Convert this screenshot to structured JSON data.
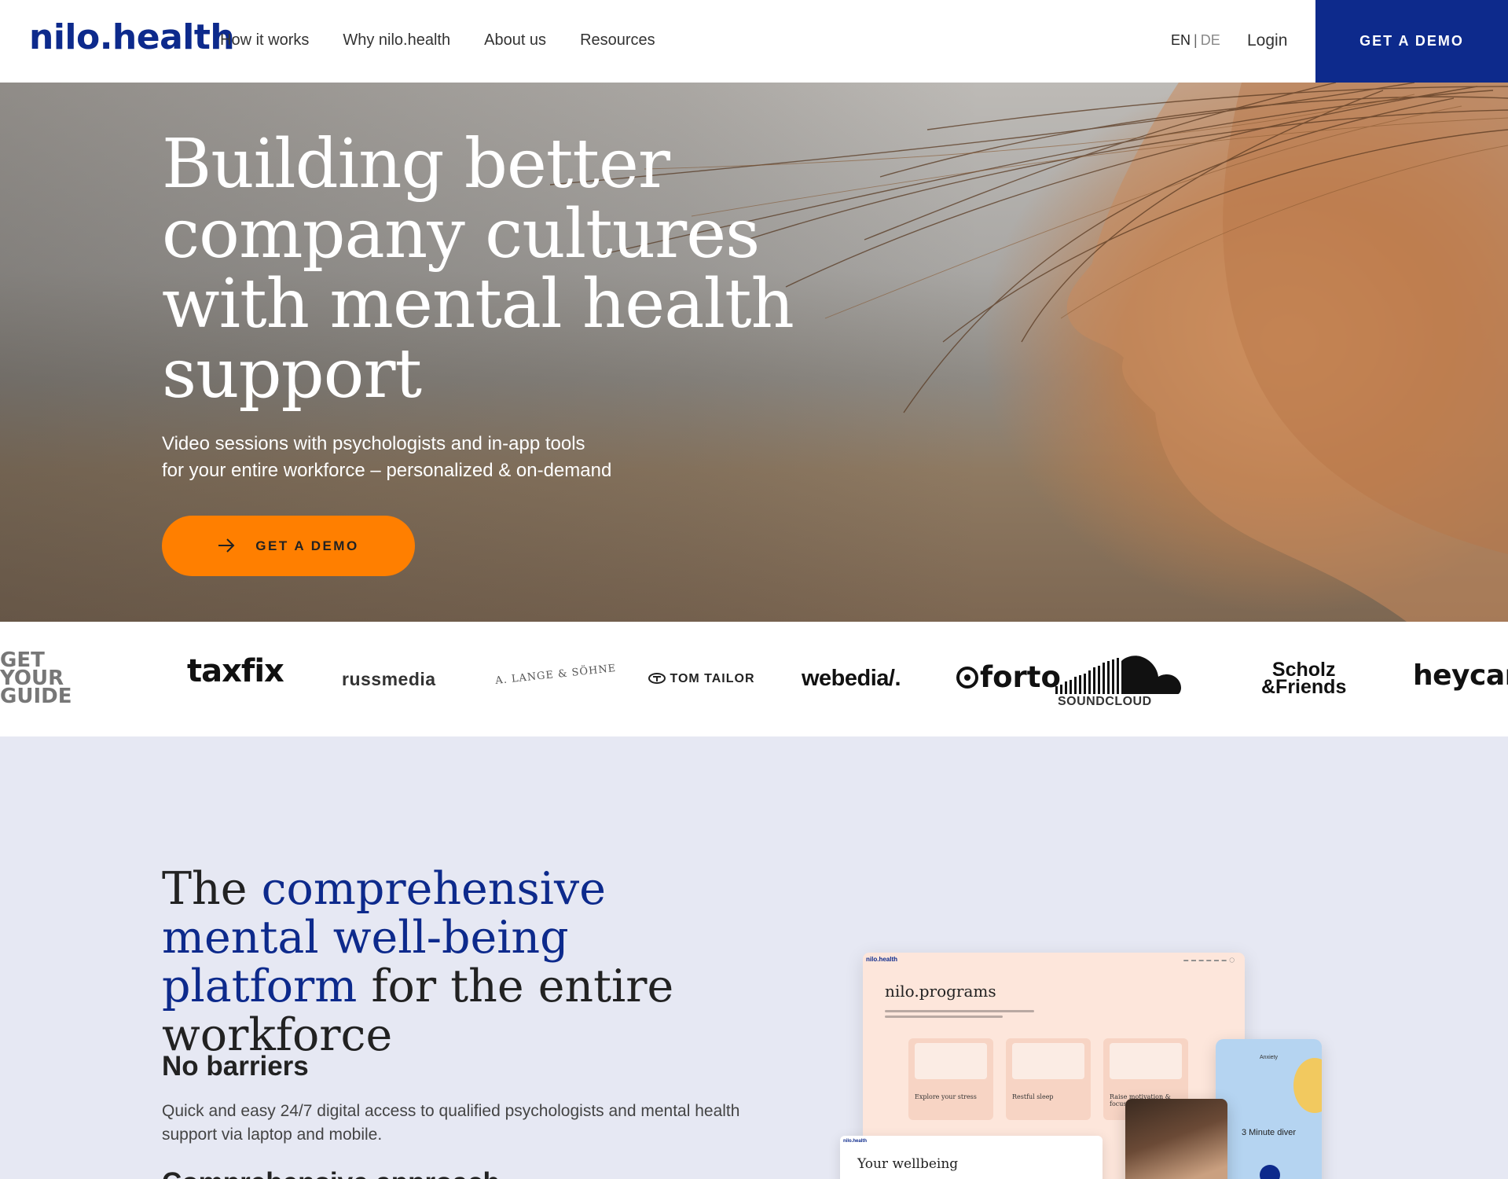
{
  "nav": {
    "logo": "nilo.health",
    "links": [
      "How it works",
      "Why nilo.health",
      "About us",
      "Resources"
    ],
    "lang_en": "EN",
    "lang_sep": "|",
    "lang_de": "DE",
    "login": "Login",
    "cta": "GET A DEMO"
  },
  "hero": {
    "title": "Building better company cultures with mental health support",
    "subtitle_line1": "Video sessions with psychologists and in-app tools",
    "subtitle_line2": "for your entire workforce – personalized & on-demand",
    "cta": "GET A DEMO",
    "cta_icon": "arrow-right-icon"
  },
  "client_logos": {
    "getyourguide": [
      "GET",
      "YOUR",
      "GUIDE"
    ],
    "taxfix": "taxfix",
    "russmedia": "russmedia",
    "lange": "A. LANGE & SÖHNE",
    "tomtailor": "TOM TAILOR",
    "webedia": "webedia/.",
    "forto": "forto",
    "soundcloud": "SOUNDCLOUD",
    "scholz": [
      "Scholz",
      "&Friends"
    ],
    "heycar": "heycar"
  },
  "platform": {
    "title_pre": "The ",
    "title_highlight": "comprehensive mental well-being platform",
    "title_post": " for the entire workforce",
    "feature1_title": "No barriers",
    "feature1_body": "Quick and easy 24/7 digital access to qualified psychologists and mental health support via laptop and mobile.",
    "feature2_title": "Comprehensive approach"
  },
  "mockups": {
    "programs_brand": "nilo.health",
    "programs_title": "nilo.programs",
    "card_titles": [
      "Explore your stress",
      "Restful sleep",
      "Raise motivation & focus"
    ],
    "phone_title": "Anxiety",
    "phone_heading": "3 Minute diver",
    "wellbeing_brand": "nilo.health",
    "wellbeing_title": "Your wellbeing"
  },
  "colors": {
    "brand_blue": "#0d2a8c",
    "cta_orange": "#ff7f00",
    "section_bg": "#e6e8f3"
  }
}
